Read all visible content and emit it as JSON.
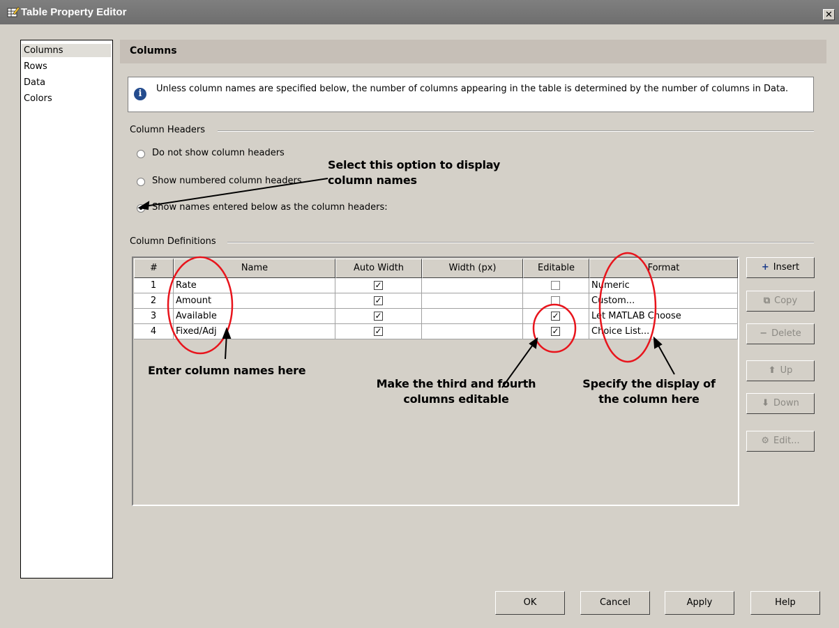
{
  "window": {
    "title": "Table Property Editor",
    "close_glyph": "✕"
  },
  "nav": {
    "items": [
      "Columns",
      "Rows",
      "Data",
      "Colors"
    ],
    "selected": "Columns"
  },
  "section": {
    "title": "Columns"
  },
  "info": {
    "icon": "info-icon",
    "text": "Unless column names are specified below, the number of columns appearing in the table is determined by the number of columns in Data."
  },
  "column_headers": {
    "label": "Column Headers",
    "options": [
      {
        "label": "Do not show column headers",
        "checked": false
      },
      {
        "label": "Show numbered column headers",
        "checked": false
      },
      {
        "label": "Show names entered below as the column headers:",
        "checked": true
      }
    ]
  },
  "column_definitions": {
    "label": "Column Definitions",
    "columns": [
      "#",
      "Name",
      "Auto Width",
      "Width (px)",
      "Editable",
      "Format"
    ],
    "rows": [
      {
        "num": "1",
        "name": "Rate",
        "auto_width": true,
        "width": "",
        "editable": false,
        "format": "Numeric"
      },
      {
        "num": "2",
        "name": "Amount",
        "auto_width": true,
        "width": "",
        "editable": false,
        "format": "Custom..."
      },
      {
        "num": "3",
        "name": "Available",
        "auto_width": true,
        "width": "",
        "editable": true,
        "format": "Let MATLAB Choose"
      },
      {
        "num": "4",
        "name": "Fixed/Adj",
        "auto_width": true,
        "width": "",
        "editable": true,
        "format": "Choice List..."
      }
    ]
  },
  "side_buttons": {
    "insert": "Insert",
    "copy": "Copy",
    "delete": "Delete",
    "up": "Up",
    "down": "Down",
    "edit": "Edit..."
  },
  "footer": {
    "ok": "OK",
    "cancel": "Cancel",
    "apply": "Apply",
    "help": "Help"
  },
  "annotations": {
    "select_option_1": "Select this option to display",
    "select_option_2": "column names",
    "enter_names": "Enter column names here",
    "editable_1": "Make the third and fourth",
    "editable_2": "columns editable",
    "format_1": "Specify the display of",
    "format_2": "the column here"
  },
  "colors": {
    "annotation_circle": "#e8141c",
    "title_bar": "#747474",
    "header_bar": "#c6bfb7"
  }
}
